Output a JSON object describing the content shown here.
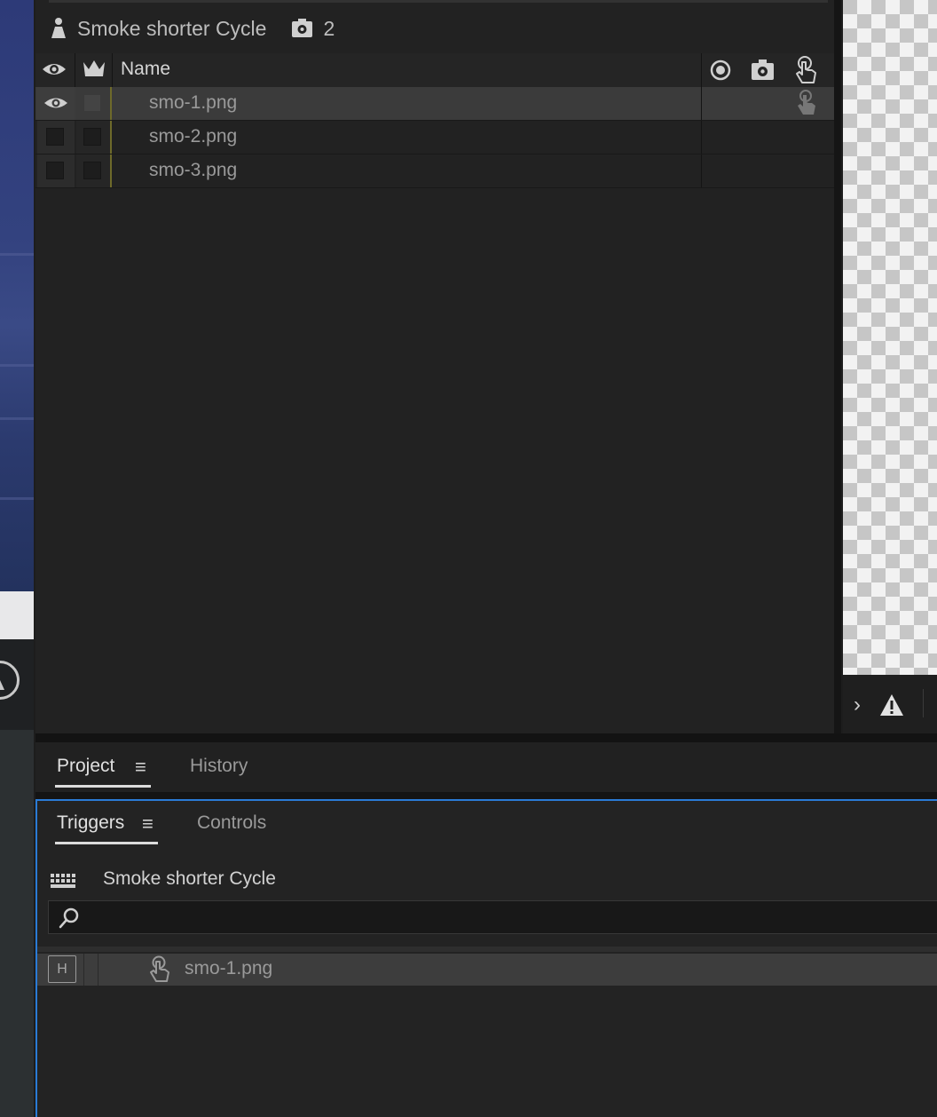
{
  "layers_panel": {
    "comp_title": "Smoke shorter Cycle",
    "camera_count": "2",
    "column_name": "Name",
    "rows": [
      {
        "name": "smo-1.png",
        "selected": true
      },
      {
        "name": "smo-2.png",
        "selected": false
      },
      {
        "name": "smo-3.png",
        "selected": false
      }
    ]
  },
  "project_tabs": {
    "project": "Project",
    "history": "History"
  },
  "triggers_panel": {
    "tab_triggers": "Triggers",
    "tab_controls": "Controls",
    "title": "Smoke shorter Cycle",
    "search_placeholder": "",
    "row": {
      "key": "H",
      "name": "smo-1.png"
    }
  },
  "icons": [
    "eye-icon",
    "crown-icon",
    "record-icon",
    "camera-gear-icon",
    "hand-pointer-icon",
    "puppet-icon",
    "warning-icon",
    "chevron-right-icon",
    "keyboard-icon",
    "search-icon",
    "menu-icon"
  ],
  "colors": {
    "accent": "#2a7bd6",
    "selected_row": "#3b3b3b",
    "panel_bg": "#222222"
  }
}
